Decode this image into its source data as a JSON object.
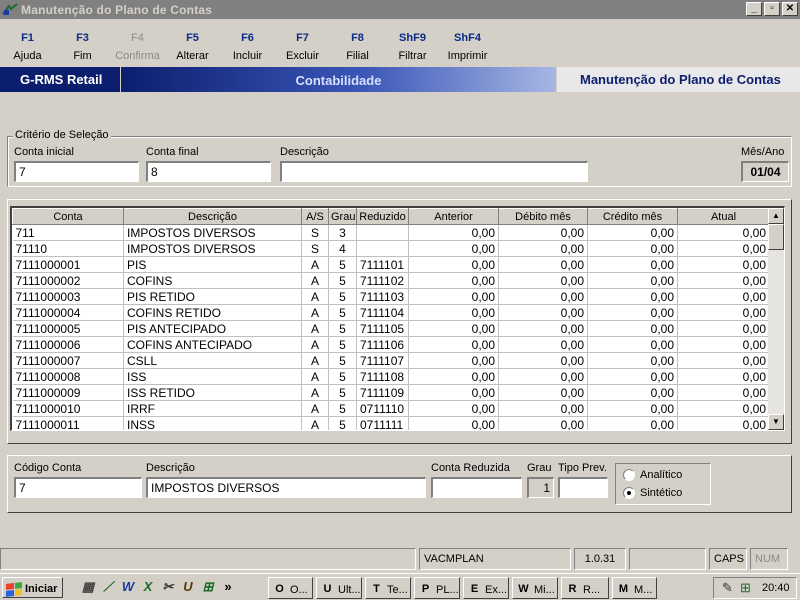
{
  "window": {
    "title": "Manutenção do Plano de Contas"
  },
  "toolbar": [
    {
      "key": "F1",
      "label": "Ajuda",
      "enabled": true
    },
    {
      "key": "F3",
      "label": "Fim",
      "enabled": true
    },
    {
      "key": "F4",
      "label": "Confirma",
      "enabled": false
    },
    {
      "key": "F5",
      "label": "Alterar",
      "enabled": true
    },
    {
      "key": "F6",
      "label": "Incluir",
      "enabled": true
    },
    {
      "key": "F7",
      "label": "Excluir",
      "enabled": true
    },
    {
      "key": "F8",
      "label": "Filial",
      "enabled": true
    },
    {
      "key": "ShF9",
      "label": "Filtrar",
      "enabled": true
    },
    {
      "key": "ShF4",
      "label": "Imprimir",
      "enabled": true
    }
  ],
  "header": {
    "left": "G-RMS Retail",
    "middle": "Contabilidade",
    "right": "Manutenção do Plano de Contas"
  },
  "criteria": {
    "group_title": "Critério de Seleção",
    "conta_inicial_label": "Conta inicial",
    "conta_inicial": "7",
    "conta_final_label": "Conta final",
    "conta_final": "8",
    "descricao_label": "Descrição",
    "descricao": "",
    "mes_ano_label": "Mês/Ano",
    "mes_ano": "01/04"
  },
  "grid": {
    "columns": [
      "Conta",
      "Descrição",
      "A/S",
      "Grau",
      "Reduzido",
      "Anterior",
      "Débito mês",
      "Crédito mês",
      "Atual"
    ],
    "rows": [
      [
        "711",
        "IMPOSTOS DIVERSOS",
        "S",
        "3",
        "",
        "0,00",
        "0,00",
        "0,00",
        "0,00"
      ],
      [
        "71110",
        "IMPOSTOS DIVERSOS",
        "S",
        "4",
        "",
        "0,00",
        "0,00",
        "0,00",
        "0,00"
      ],
      [
        "7111000001",
        "PIS",
        "A",
        "5",
        "7111101",
        "0,00",
        "0,00",
        "0,00",
        "0,00"
      ],
      [
        "7111000002",
        "COFINS",
        "A",
        "5",
        "7111102",
        "0,00",
        "0,00",
        "0,00",
        "0,00"
      ],
      [
        "7111000003",
        "PIS RETIDO",
        "A",
        "5",
        "7111103",
        "0,00",
        "0,00",
        "0,00",
        "0,00"
      ],
      [
        "7111000004",
        "COFINS RETIDO",
        "A",
        "5",
        "7111104",
        "0,00",
        "0,00",
        "0,00",
        "0,00"
      ],
      [
        "7111000005",
        "PIS ANTECIPADO",
        "A",
        "5",
        "7111105",
        "0,00",
        "0,00",
        "0,00",
        "0,00"
      ],
      [
        "7111000006",
        "COFINS ANTECIPADO",
        "A",
        "5",
        "7111106",
        "0,00",
        "0,00",
        "0,00",
        "0,00"
      ],
      [
        "7111000007",
        "CSLL",
        "A",
        "5",
        "7111107",
        "0,00",
        "0,00",
        "0,00",
        "0,00"
      ],
      [
        "7111000008",
        "ISS",
        "A",
        "5",
        "7111108",
        "0,00",
        "0,00",
        "0,00",
        "0,00"
      ],
      [
        "7111000009",
        "ISS RETIDO",
        "A",
        "5",
        "7111109",
        "0,00",
        "0,00",
        "0,00",
        "0,00"
      ],
      [
        "7111000010",
        "IRRF",
        "A",
        "5",
        "0711110",
        "0,00",
        "0,00",
        "0,00",
        "0,00"
      ],
      [
        "7111000011",
        "INSS",
        "A",
        "5",
        "0711111",
        "0,00",
        "0,00",
        "0,00",
        "0,00"
      ]
    ]
  },
  "detail": {
    "codigo_label": "Código Conta",
    "codigo": "7",
    "descricao_label": "Descrição",
    "descricao": "IMPOSTOS DIVERSOS",
    "reduzida_label": "Conta Reduzida",
    "reduzida": "",
    "grau_label": "Grau",
    "grau": "1",
    "tipo_label": "Tipo Prev.",
    "tipo": "",
    "analitico_label": "Analítico",
    "sintetico_label": "Sintético",
    "selected": "sintetico"
  },
  "statusbar": {
    "program": "VACMPLAN",
    "version": "1.0.31",
    "caps": "CAPS",
    "num": "NUM"
  },
  "taskbar": {
    "start": "Iniciar",
    "quick_icons": [
      "calculator-icon",
      "grms-icon",
      "word-icon",
      "excel-icon",
      "tools-icon",
      "ultra-icon",
      "network-icon"
    ],
    "more": "»",
    "tasks": [
      {
        "label": "O...",
        "icon": "outlook-icon",
        "glyph": "O"
      },
      {
        "label": "Ult...",
        "icon": "ultraedit-icon",
        "glyph": "U"
      },
      {
        "label": "Te...",
        "icon": "terminal-icon",
        "glyph": "T"
      },
      {
        "label": "PL...",
        "icon": "sheet-icon",
        "glyph": "P"
      },
      {
        "label": "Ex...",
        "icon": "explorer-icon",
        "glyph": "E"
      },
      {
        "label": "Mi...",
        "icon": "word-icon",
        "glyph": "W"
      },
      {
        "label": "R...",
        "icon": "grms-icon",
        "glyph": "R"
      },
      {
        "label": "M...",
        "icon": "grms-icon",
        "glyph": "M"
      }
    ],
    "clock": "20:40"
  },
  "colors": {
    "navy": "#0c1e6e",
    "face": "#d4d0c8",
    "fkey": "#0a2a88"
  }
}
